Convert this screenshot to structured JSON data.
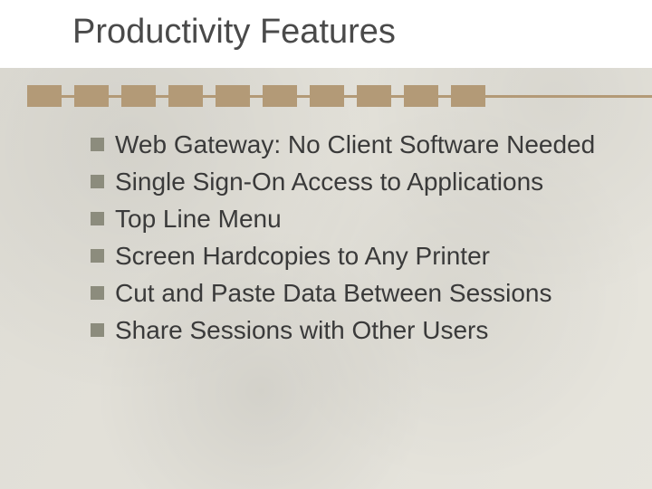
{
  "title": "Productivity Features",
  "bullets": [
    "Web Gateway: No Client Software Needed",
    "Single Sign-On Access to Applications",
    "Top Line Menu",
    "Screen Hardcopies to Any Printer",
    "Cut and Paste Data Between Sessions",
    "Share Sessions with Other Users"
  ]
}
